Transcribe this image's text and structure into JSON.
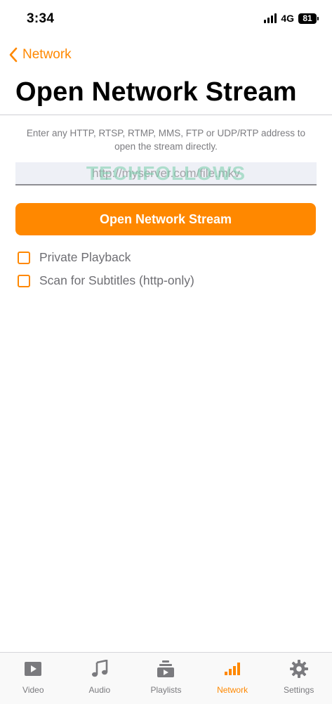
{
  "status_bar": {
    "time": "3:34",
    "network_type": "4G",
    "battery": "81"
  },
  "nav": {
    "back_label": "Network"
  },
  "page": {
    "title": "Open Network Stream",
    "description": "Enter any HTTP, RTSP, RTMP, MMS, FTP or UDP/RTP address to open the stream directly.",
    "url_placeholder": "http://myserver.com/file.mkv",
    "url_value": "",
    "watermark": "TECHFOLLOWS",
    "open_button_label": "Open Network Stream"
  },
  "options": [
    {
      "label": "Private Playback",
      "checked": false
    },
    {
      "label": "Scan for Subtitles (http-only)",
      "checked": false
    }
  ],
  "tab_bar": {
    "active": "Network",
    "tabs": [
      {
        "label": "Video",
        "icon": "video-icon"
      },
      {
        "label": "Audio",
        "icon": "music-note-icon"
      },
      {
        "label": "Playlists",
        "icon": "playlist-icon"
      },
      {
        "label": "Network",
        "icon": "network-bars-icon"
      },
      {
        "label": "Settings",
        "icon": "gear-icon"
      }
    ]
  },
  "colors": {
    "accent": "#ff8800",
    "inactive_tab": "#7a7a7e",
    "secondary_text": "#7c7c80"
  }
}
